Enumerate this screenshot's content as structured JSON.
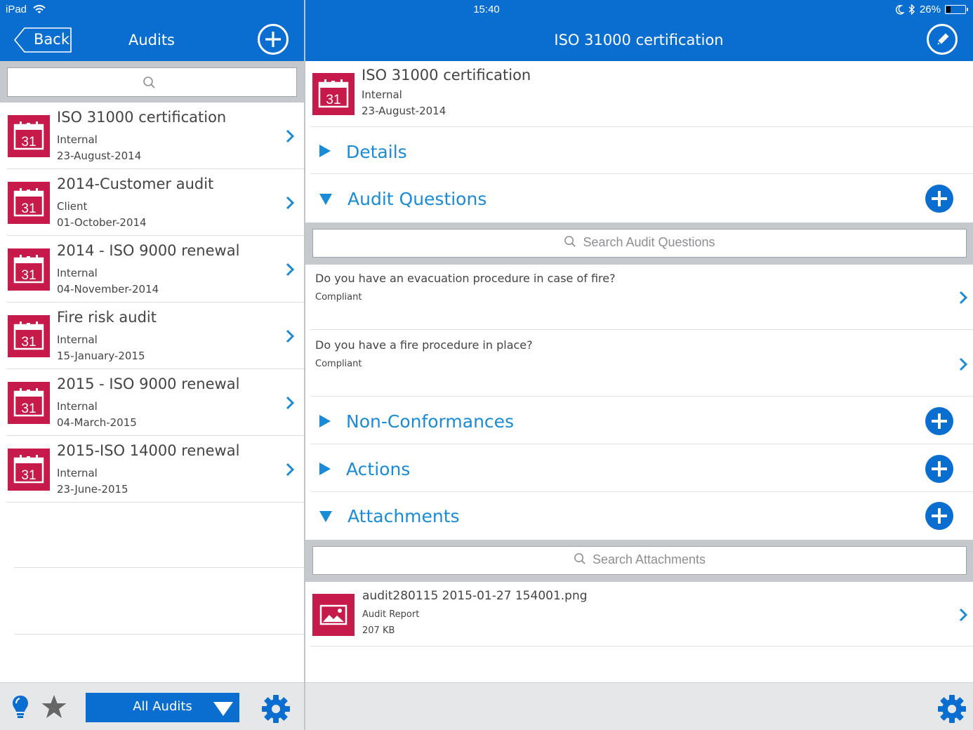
{
  "status_bar": {
    "device": "iPad",
    "time": "15:40",
    "battery": "26%"
  },
  "left_header": {
    "back_label": "Back",
    "title": "Audits"
  },
  "right_header": {
    "title": "ISO 31000 certification"
  },
  "audits": [
    {
      "title": "ISO 31000 certification",
      "type": "Internal",
      "date": "23-August-2014",
      "icon_day": "31"
    },
    {
      "title": "2014-Customer audit",
      "type": "Client",
      "date": "01-October-2014",
      "icon_day": "31"
    },
    {
      "title": "2014 - ISO 9000 renewal",
      "type": "Internal",
      "date": "04-November-2014",
      "icon_day": "31"
    },
    {
      "title": "Fire risk audit",
      "type": "Internal",
      "date": "15-January-2015",
      "icon_day": "31"
    },
    {
      "title": "2015 - ISO 9000 renewal",
      "type": "Internal",
      "date": "04-March-2015",
      "icon_day": "31"
    },
    {
      "title": "2015-ISO 14000 renewal",
      "type": "Internal",
      "date": "23-June-2015",
      "icon_day": "31"
    }
  ],
  "left_footer": {
    "filter_label": "All Audits"
  },
  "detail": {
    "title": "ISO 31000 certification",
    "type": "Internal",
    "date": "23-August-2014",
    "icon_day": "31",
    "sections": {
      "details": "Details",
      "audit_questions": "Audit Questions",
      "non_conformances": "Non-Conformances",
      "actions": "Actions",
      "attachments": "Attachments"
    },
    "questions_search_placeholder": "Search Audit Questions",
    "questions": [
      {
        "text": "Do you have an evacuation procedure in case of fire?",
        "status": "Compliant"
      },
      {
        "text": "Do you have a fire procedure in place?",
        "status": "Compliant"
      }
    ],
    "attachments_search_placeholder": "Search Attachments",
    "attachment": {
      "name": "audit280115 2015-01-27 154001.png",
      "type": "Audit Report",
      "size": "207 KB"
    }
  },
  "colors": {
    "header_blue": "#0a6ed1",
    "icon_red": "#c51a4a",
    "section_blue": "#1a8bd6"
  }
}
